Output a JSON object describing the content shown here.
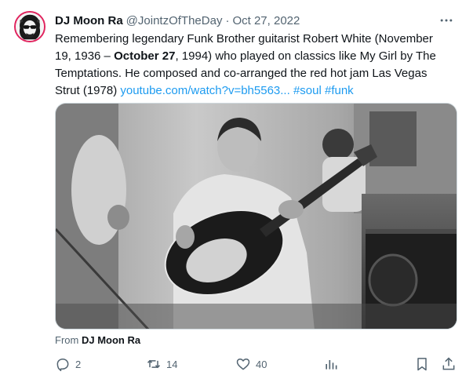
{
  "author": {
    "display_name": "DJ Moon Ra",
    "handle": "@JointzOfTheDay",
    "separator": "·",
    "date": "Oct 27, 2022"
  },
  "tweet": {
    "text_1": "Remembering legendary Funk Brother guitarist Robert White (November 19, 1936 – ",
    "text_bold": "October 27",
    "text_2": ", 1994) who played on classics like My Girl by The Temptations. He composed and co-arranged the red hot jam Las Vegas Strut (1978) ",
    "link": "youtube.com/watch?v=bh5563...",
    "hashtag_1": "#soul",
    "hashtag_2": "#funk"
  },
  "media": {
    "from_label": "From",
    "from_name": "DJ Moon Ra"
  },
  "actions": {
    "replies": "2",
    "retweets": "14",
    "likes": "40"
  },
  "icons": {
    "more": "more-icon",
    "reply": "reply-icon",
    "retweet": "retweet-icon",
    "like": "heart-icon",
    "views": "analytics-icon",
    "bookmark": "bookmark-icon",
    "share": "share-icon"
  },
  "colors": {
    "link": "#1d9bf0",
    "muted": "#536471",
    "text": "#0f1419"
  }
}
